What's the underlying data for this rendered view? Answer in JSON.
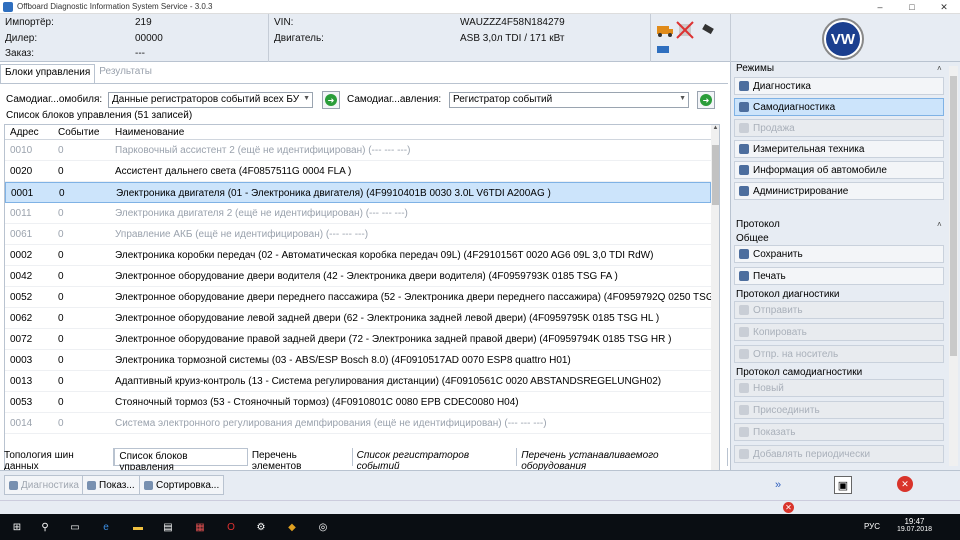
{
  "window": {
    "title": "Offboard Diagnostic Information System Service - 3.0.3",
    "min": "–",
    "max": "□",
    "close": "✕"
  },
  "header": {
    "importer_label": "Импортёр:",
    "importer_value": "219",
    "dealer_label": "Дилер:",
    "dealer_value": "00000",
    "order_label": "Заказ:",
    "order_value": "---",
    "vin_label": "VIN:",
    "vin_value": "WAUZZZ4F58N184279",
    "engine_label": "Двигатель:",
    "engine_value": "ASB 3,0л TDI / 171 кВт",
    "logo_text": "VW"
  },
  "tabs": {
    "control_units": "Блоки управления",
    "results": "Результаты"
  },
  "filter": {
    "label1": "Самодиаг...омобиля:",
    "combo1": "Данные регистраторов событий всех БУ",
    "label2": "Самодиаг...авления:",
    "combo2": "Регистратор событий"
  },
  "list_title": "Список блоков управления (51 записей)",
  "table": {
    "headers": {
      "address": "Адрес",
      "event": "Событие",
      "name": "Наименование"
    },
    "rows": [
      {
        "address": "0010",
        "event": "0",
        "name": "Парковочный ассистент 2 (ещё не идентифицирован) (---   ---   ---)"
      },
      {
        "address": "0020",
        "event": "0",
        "name": "Ассистент дальнего света (4F0857511G    0004   FLA         )"
      },
      {
        "address": "0001",
        "event": "0",
        "name": "Электроника двигателя (01 - Электроника двигателя) (4F9910401B     0030   3.0L V6TDI  A200AG )"
      },
      {
        "address": "0011",
        "event": "0",
        "name": "Электроника двигателя 2 (ещё не идентифицирован) (---   ---   ---)"
      },
      {
        "address": "0061",
        "event": "0",
        "name": "Управление АКБ (ещё не идентифицирован) (---   ---   ---)"
      },
      {
        "address": "0002",
        "event": "0",
        "name": "Электроника коробки передач (02 - Автоматическая коробка передач 09L) (4F2910156T     0020   AG6 09L 3,0 TDI RdW)"
      },
      {
        "address": "0042",
        "event": "0",
        "name": "Электронное оборудование двери водителя (42 - Электроника двери водителя) (4F0959793K    0185   TSG FA       )"
      },
      {
        "address": "0052",
        "event": "0",
        "name": "Электронное оборудование двери переднего пассажира (52 - Электроника двери переднего пассажира) (4F0959792Q     0250   TSG BF"
      },
      {
        "address": "0062",
        "event": "0",
        "name": "Электронное оборудование левой задней двери (62 - Электроника задней левой двери) (4F0959795K     0185   TSG HL       )"
      },
      {
        "address": "0072",
        "event": "0",
        "name": "Электронное оборудование правой задней двери (72 - Электроника задней правой двери) (4F0959794K     0185   TSG HR       )"
      },
      {
        "address": "0003",
        "event": "0",
        "name": "Электроника тормозной системы (03 - ABS/ESP Bosch 8.0) (4F0910517AD     0070   ESP8 quattro     H01)"
      },
      {
        "address": "0013",
        "event": "0",
        "name": "Адаптивный круиз-контроль (13 - Система регулирования дистанции) (4F0910561C     0020   ABSTANDSREGELUNGH02)"
      },
      {
        "address": "0053",
        "event": "0",
        "name": "Стояночный тормоз (53 - Стояночный тормоз) (4F0910801C     0080   EPB  CDEC0080   H04)"
      },
      {
        "address": "0014",
        "event": "0",
        "name": "Система электронного регулирования демпфирования (ещё не идентифицирован) (---   ---   ---)"
      }
    ]
  },
  "bottom_tabs": [
    "Топология шин данных",
    "Список блоков управления",
    "Перечень элементов",
    "Список регистраторов событий",
    "Перечень устанавливаемого оборудования"
  ],
  "bottom_buttons": {
    "diag": "Диагностика",
    "show": "Показ...",
    "sort": "Сортировка..."
  },
  "right": {
    "modes_header": "Режимы",
    "modes": [
      "Диагностика",
      "Самодиагностика",
      "Продажа",
      "Измерительная техника",
      "Информация об автомобиле",
      "Администрирование"
    ],
    "protocol_header": "Протокол",
    "general_header": "Общее",
    "general": [
      "Сохранить",
      "Печать"
    ],
    "diag_proto_header": "Протокол диагностики",
    "diag_proto": [
      "Отправить",
      "Копировать",
      "Отпр. на носитель"
    ],
    "selfdiag_proto_header": "Протокол самодиагностики",
    "selfdiag_proto": [
      "Новый",
      "Присоединить",
      "Показать",
      "Добавлять периодически"
    ],
    "collapse": "˄"
  },
  "taskbar": {
    "lang": "РУС",
    "time": "19:47",
    "date": "19.07.2018"
  }
}
